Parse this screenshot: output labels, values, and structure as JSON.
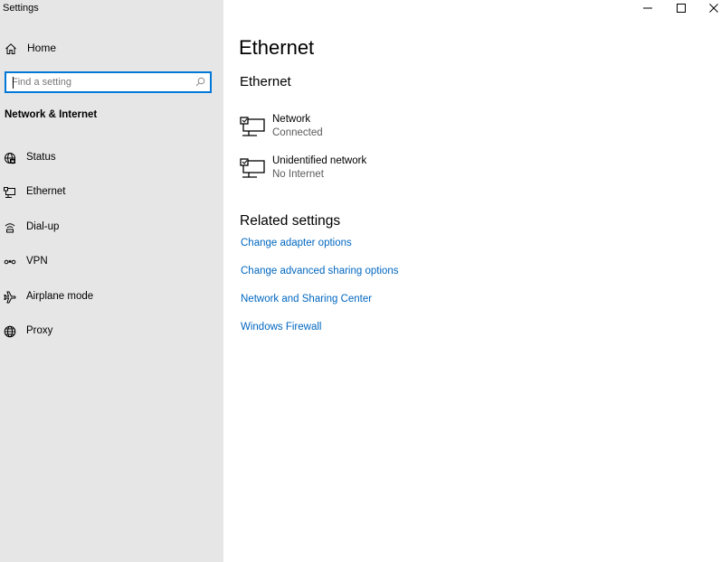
{
  "app": {
    "title": "Settings"
  },
  "sidebar": {
    "home_label": "Home",
    "search": {
      "placeholder": "Find a setting",
      "value": ""
    },
    "section_title": "Network & Internet",
    "items": [
      {
        "label": "Status",
        "icon": "status-globe-icon"
      },
      {
        "label": "Ethernet",
        "icon": "ethernet-icon"
      },
      {
        "label": "Dial-up",
        "icon": "dialup-icon"
      },
      {
        "label": "VPN",
        "icon": "vpn-icon"
      },
      {
        "label": "Airplane mode",
        "icon": "airplane-icon"
      },
      {
        "label": "Proxy",
        "icon": "proxy-globe-icon"
      }
    ]
  },
  "titlebar": {
    "controls": [
      "minimize",
      "maximize",
      "close"
    ]
  },
  "main": {
    "page_title": "Ethernet",
    "subtitle": "Ethernet",
    "networks": [
      {
        "name": "Network",
        "status": "Connected",
        "icon": "network-adapter-icon"
      },
      {
        "name": "Unidentified network",
        "status": "No Internet",
        "icon": "network-adapter-icon"
      }
    ],
    "related_title": "Related settings",
    "related_links": [
      "Change adapter options",
      "Change advanced sharing options",
      "Network and Sharing Center",
      "Windows Firewall"
    ]
  },
  "colors": {
    "sidebar_bg": "#e6e6e6",
    "accent": "#0078d7",
    "link": "#0067c0"
  }
}
